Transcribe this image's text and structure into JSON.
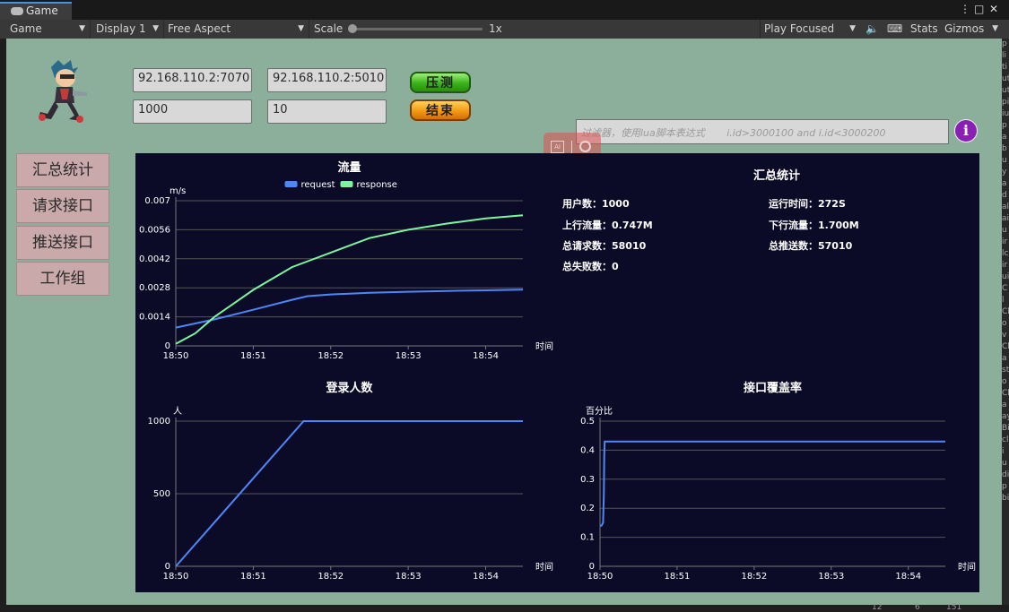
{
  "window": {
    "tab_title": "Game",
    "menu_glyph": "⋮",
    "max_glyph": "□",
    "close_glyph": "✕"
  },
  "toolbar": {
    "view": "Game",
    "display": "Display 1",
    "aspect": "Free Aspect",
    "scale_label": "Scale",
    "scale_value": "1x",
    "play_mode": "Play Focused",
    "stats": "Stats",
    "gizmos": "Gizmos"
  },
  "right_panel_letters": [
    "p",
    "li",
    "ti",
    "ut",
    "ut",
    "pi",
    "iu",
    "p",
    "a",
    "b",
    "u",
    "y",
    "a",
    "d",
    "al",
    "ai",
    "u",
    "ir",
    "lc",
    "ir",
    "ui",
    "C",
    "l",
    "Cl",
    "o",
    "v",
    "Cl",
    "a",
    "st",
    "o",
    "Cl",
    "a",
    "ay",
    "Bi",
    "cl",
    "i",
    "u",
    "di",
    "p",
    "bi"
  ],
  "status": {
    "info_count": "12",
    "warn_count": "6",
    "error_count": "151"
  },
  "server": {
    "address_1": "92.168.110.2:7070",
    "address_2": "92.168.110.2:5010",
    "users": "1000",
    "rate": "10"
  },
  "buttons": {
    "start": "压测",
    "stop": "结束"
  },
  "filter": {
    "placeholder": "过滤器，使用lua脚本表达式       i.id>3000100 and i.id<3000200"
  },
  "nav": [
    {
      "label": "汇总统计"
    },
    {
      "label": "请求接口"
    },
    {
      "label": "推送接口"
    },
    {
      "label": "工作组"
    }
  ],
  "summary": {
    "title": "汇总统计",
    "users_label": "用户数：",
    "users": "1000",
    "runtime_label": "运行时间：",
    "runtime": "272S",
    "up_label": "上行流量：",
    "up": "0.747M",
    "down_label": "下行流量：",
    "down": "1.700M",
    "requests_label": "总请求数：",
    "requests": "58010",
    "pushes_label": "总推送数：",
    "pushes": "57010",
    "failures_label": "总失败数：",
    "failures": "0"
  },
  "colors": {
    "request": "#4f86f7",
    "response": "#7cf59f",
    "panel_bg": "#0c0b27",
    "game_bg": "#8baf9a"
  },
  "chart_data": [
    {
      "type": "line",
      "title": "流量",
      "ylabel": "m/s",
      "xlabel": "时间",
      "x_ticks": [
        "18:50",
        "18:51",
        "18:52",
        "18:53",
        "18:54"
      ],
      "y_ticks": [
        "0",
        "0.0014",
        "0.0028",
        "0.0042",
        "0.0056",
        "0.007"
      ],
      "ylim": [
        0,
        0.007
      ],
      "xlim": [
        0,
        4.48
      ],
      "legend": "top-center",
      "grid": true,
      "series": [
        {
          "name": "request",
          "color": "#4f86f7",
          "x": [
            0,
            0.5,
            1,
            1.5,
            1.7,
            2,
            2.5,
            3,
            3.5,
            4,
            4.48
          ],
          "y": [
            0.00088,
            0.00128,
            0.00174,
            0.00222,
            0.0024,
            0.00248,
            0.00256,
            0.00261,
            0.00265,
            0.00268,
            0.00271
          ]
        },
        {
          "name": "response",
          "color": "#7cf59f",
          "x": [
            0,
            0.25,
            0.5,
            1,
            1.5,
            1.75,
            2,
            2.5,
            3,
            3.5,
            4,
            4.48
          ],
          "y": [
            0.0001,
            0.0006,
            0.0014,
            0.0027,
            0.0038,
            0.00415,
            0.0045,
            0.0052,
            0.0056,
            0.0059,
            0.00615,
            0.0063
          ]
        }
      ]
    },
    {
      "type": "line",
      "title": "登录人数",
      "ylabel": "人",
      "xlabel": "时间",
      "x_ticks": [
        "18:50",
        "18:51",
        "18:52",
        "18:53",
        "18:54"
      ],
      "y_ticks": [
        "0",
        "500",
        "1000"
      ],
      "ylim": [
        0,
        1000
      ],
      "xlim": [
        0,
        4.48
      ],
      "grid": true,
      "series": [
        {
          "color": "#4f86f7",
          "x": [
            0,
            1.65,
            4.48
          ],
          "y": [
            0,
            1000,
            1000
          ]
        }
      ]
    },
    {
      "type": "line",
      "title": "接口覆盖率",
      "ylabel": "百分比",
      "xlabel": "时间",
      "x_ticks": [
        "18:50",
        "18:51",
        "18:52",
        "18:53",
        "18:54"
      ],
      "y_ticks": [
        "0",
        "0.1",
        "0.2",
        "0.3",
        "0.4",
        "0.5"
      ],
      "ylim": [
        0,
        0.5
      ],
      "xlim": [
        0,
        4.48
      ],
      "grid": true,
      "series": [
        {
          "color": "#4f86f7",
          "x": [
            0,
            0.02,
            0.04,
            0.05,
            0.055,
            0.06,
            4.48
          ],
          "y": [
            0.14,
            0.14,
            0.15,
            0.25,
            0.38,
            0.43,
            0.43
          ]
        }
      ]
    }
  ]
}
